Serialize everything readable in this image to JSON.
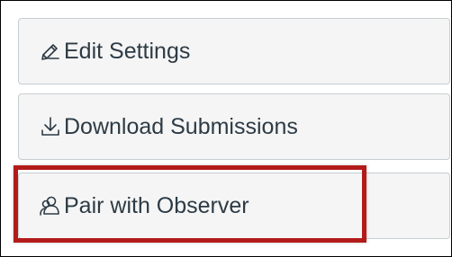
{
  "buttons": {
    "edit_settings": {
      "label": "Edit Settings",
      "icon": "pencil-icon"
    },
    "download_submissions": {
      "label": "Download Submissions",
      "icon": "download-icon"
    },
    "pair_with_observer": {
      "label": "Pair with Observer",
      "icon": "user-pair-icon"
    }
  },
  "highlight": {
    "color": "#b31b1b"
  },
  "colors": {
    "button_bg": "#f5f5f5",
    "button_border": "#c7cdd1",
    "text": "#2d3b45"
  }
}
